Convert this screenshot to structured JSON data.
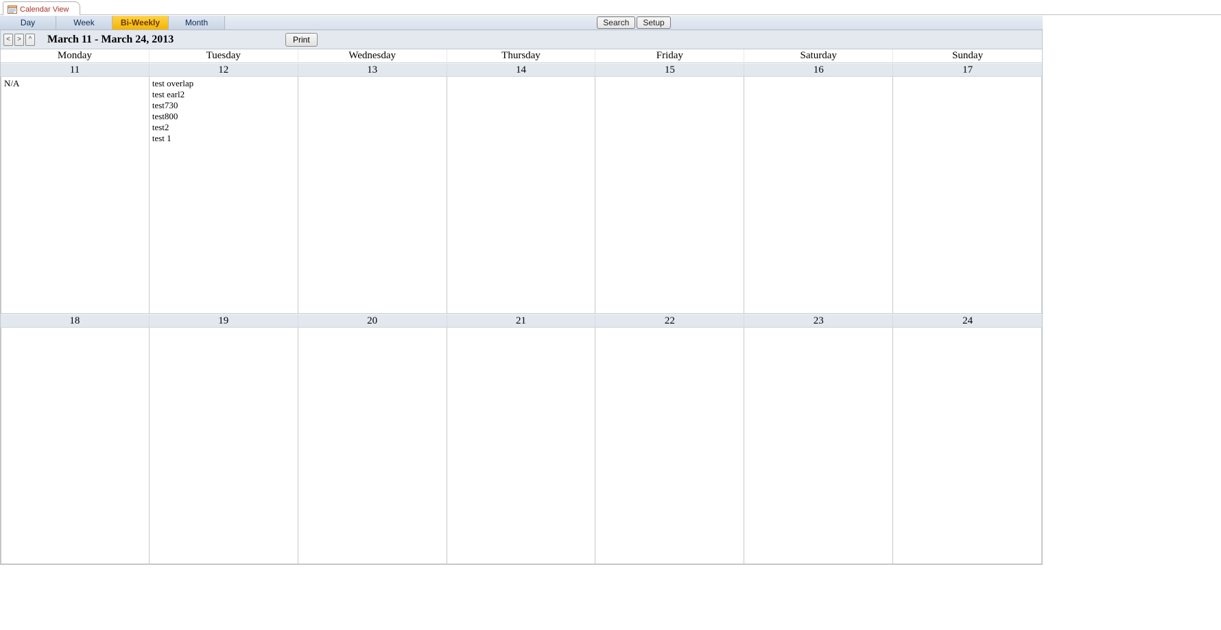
{
  "tab": {
    "title": "Calendar View"
  },
  "views": {
    "items": [
      {
        "label": "Day",
        "active": false
      },
      {
        "label": "Week",
        "active": false
      },
      {
        "label": "Bi-Weekly",
        "active": true
      },
      {
        "label": "Month",
        "active": false
      }
    ]
  },
  "toolbar": {
    "search_label": "Search",
    "setup_label": "Setup",
    "print_label": "Print"
  },
  "nav": {
    "prev_glyph": "<",
    "next_glyph": ">",
    "up_glyph": "^",
    "date_range": "March 11 - March 24, 2013"
  },
  "days_of_week": [
    "Monday",
    "Tuesday",
    "Wednesday",
    "Thursday",
    "Friday",
    "Saturday",
    "Sunday"
  ],
  "weeks": [
    {
      "dates": [
        "11",
        "12",
        "13",
        "14",
        "15",
        "16",
        "17"
      ],
      "cells": [
        {
          "events": [
            "N/A"
          ]
        },
        {
          "events": [
            "test overlap",
            "test earl2",
            "test730",
            "test800",
            "test2",
            "test 1"
          ]
        },
        {
          "events": []
        },
        {
          "events": []
        },
        {
          "events": []
        },
        {
          "events": []
        },
        {
          "events": []
        }
      ]
    },
    {
      "dates": [
        "18",
        "19",
        "20",
        "21",
        "22",
        "23",
        "24"
      ],
      "cells": [
        {
          "events": []
        },
        {
          "events": []
        },
        {
          "events": []
        },
        {
          "events": []
        },
        {
          "events": []
        },
        {
          "events": []
        },
        {
          "events": []
        }
      ]
    }
  ],
  "colors": {
    "header_bg": "#e3e8ef",
    "active_tab_bg": "#f5b500",
    "tab_title_color": "#a93226"
  }
}
